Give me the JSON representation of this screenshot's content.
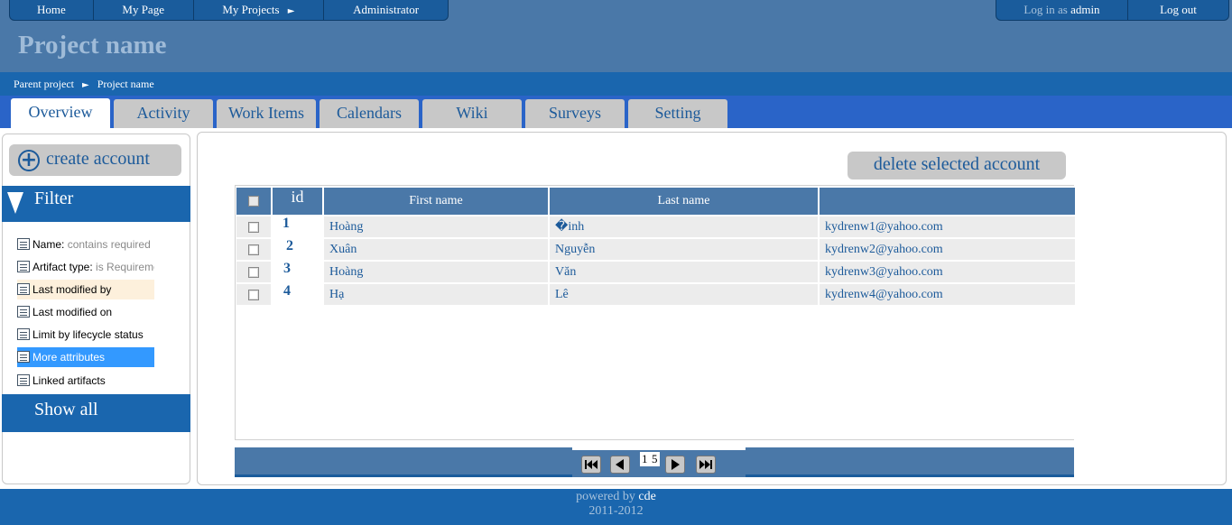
{
  "topnav": {
    "home": "Home",
    "my_page": "My Page",
    "my_projects": "My Projects",
    "my_projects_arrow": "►",
    "administrator": "Administrator",
    "login_prefix": "Log in as",
    "login_user": "admin",
    "logout": "Log out"
  },
  "project_title": "Project name",
  "breadcrumb": {
    "parent": "Parent project",
    "separator": "►",
    "current": "Project name"
  },
  "tabs": [
    {
      "label": "Overview",
      "active": true
    },
    {
      "label": "Activity"
    },
    {
      "label": "Work Items"
    },
    {
      "label": "Calendars"
    },
    {
      "label": "Wiki"
    },
    {
      "label": "Surveys"
    },
    {
      "label": "Setting"
    }
  ],
  "sidebar": {
    "create_account": "create account",
    "filter": "Filter",
    "items": [
      {
        "label": "Name:",
        "value": "contains required",
        "icon": "list-icon"
      },
      {
        "label": "Artifact type:",
        "value": "is Requirement",
        "icon": "artifact-icon"
      },
      {
        "label": "Last modified by",
        "icon": "user-icon",
        "highlight": "orange"
      },
      {
        "label": "Last modified on",
        "icon": "calendar-icon"
      },
      {
        "label": "Limit by lifecycle status",
        "icon": "lifecycle-icon"
      },
      {
        "label": "More attributes",
        "icon": "list-icon",
        "highlight": "blue"
      },
      {
        "label": "Linked artifacts",
        "icon": "link-icon"
      }
    ],
    "show_all": "Show all"
  },
  "main": {
    "delete_selected": "delete selected account",
    "table": {
      "headers": [
        "id",
        "First name",
        "Last name",
        ""
      ],
      "rows": [
        {
          "id": "1",
          "first": "Hoàng",
          "last": "�inh",
          "email": "kydrenw1@yahoo.com"
        },
        {
          "id": "2",
          "first": "Xuân",
          "last": "Nguyễn",
          "email": "kydrenw2@yahoo.com"
        },
        {
          "id": "3",
          "first": "Hoàng",
          "last": "Văn",
          "email": "kydrenw3@yahoo.com"
        },
        {
          "id": "4",
          "first": "Hạ",
          "last": "Lê",
          "email": "kydrenw4@yahoo.com"
        }
      ]
    },
    "pager": {
      "current": "1",
      "total": "5"
    }
  },
  "footer": {
    "powered_prefix": "powered by",
    "powered_name": "cde",
    "years": "2011-2012"
  },
  "colors": {
    "header_bg": "#4a78a8",
    "bar_blue": "#1a66ae",
    "tab_bar": "#2a64c8",
    "link_blue": "#1c5a9a"
  }
}
